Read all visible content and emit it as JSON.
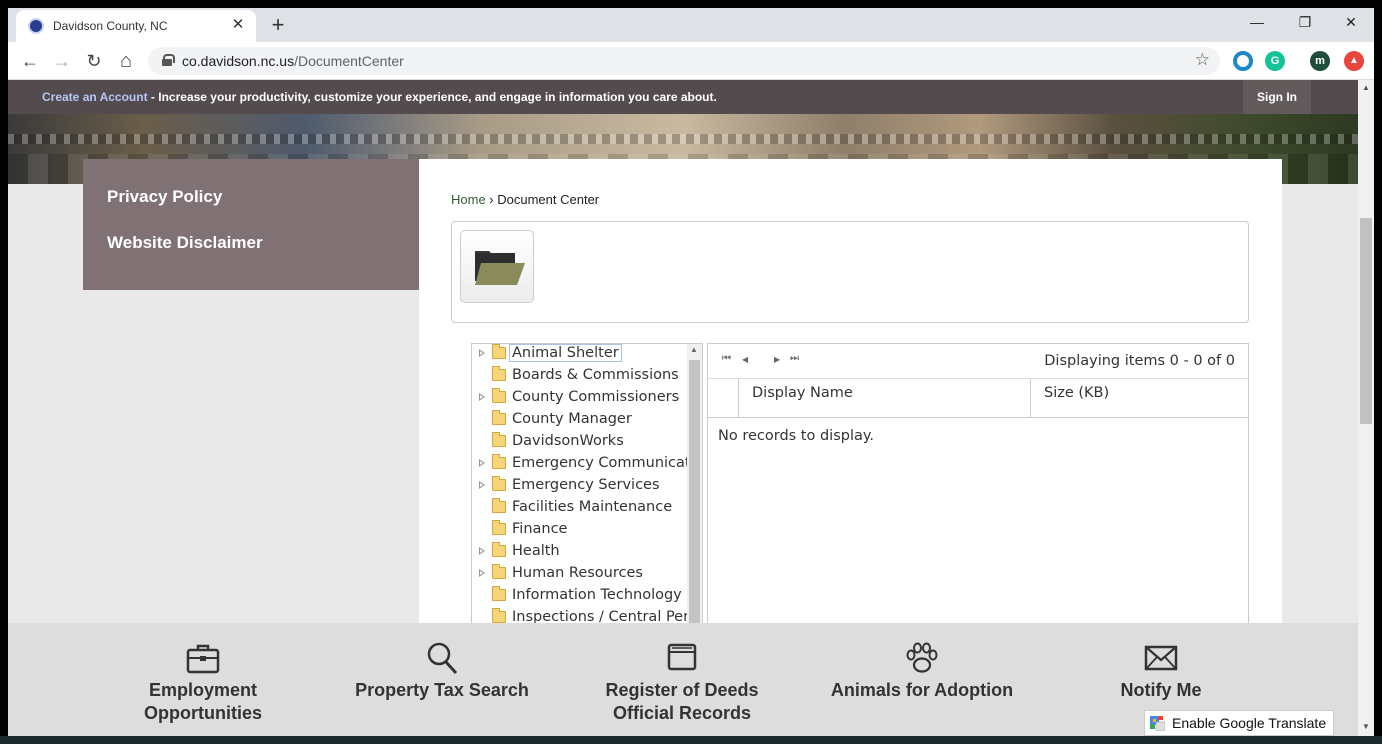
{
  "browser": {
    "tab_title": "Davidson County, NC",
    "tab_close": "✕",
    "new_tab": "+",
    "minimize": "—",
    "maximize": "❐",
    "close": "✕",
    "back": "←",
    "forward": "→",
    "reload": "↻",
    "home": "⌂",
    "url_host": "co.davidson.nc.us",
    "url_path": "/DocumentCenter",
    "bookmark_star": "☆",
    "ext_grammarly": "G",
    "profile_initial": "m"
  },
  "topbar": {
    "create_account": "Create an Account",
    "message": " - Increase your productivity, customize your experience, and engage in information you care about.",
    "sign_in": "Sign In"
  },
  "sidenav": {
    "items": [
      {
        "label": "Privacy Policy"
      },
      {
        "label": "Website Disclaimer"
      }
    ]
  },
  "breadcrumb": {
    "home": "Home",
    "separator": " › ",
    "current": "Document Center"
  },
  "tree": {
    "items": [
      {
        "label": "Animal Shelter",
        "expandable": true,
        "selected": true
      },
      {
        "label": "Boards & Commissions",
        "expandable": false
      },
      {
        "label": "County Commissioners",
        "expandable": true
      },
      {
        "label": "County Manager",
        "expandable": false
      },
      {
        "label": "DavidsonWorks",
        "expandable": false
      },
      {
        "label": "Emergency Communicati",
        "expandable": true
      },
      {
        "label": "Emergency Services",
        "expandable": true
      },
      {
        "label": "Facilities Maintenance",
        "expandable": false
      },
      {
        "label": "Finance",
        "expandable": false
      },
      {
        "label": "Health",
        "expandable": true
      },
      {
        "label": "Human Resources",
        "expandable": true
      },
      {
        "label": "Information Technology",
        "expandable": false
      },
      {
        "label": "Inspections / Central Peri",
        "expandable": false
      }
    ]
  },
  "grid": {
    "pager_first": "⏮",
    "pager_prev": "◀",
    "pager_next": "▶",
    "pager_last": "⏭",
    "info": "Displaying items 0 - 0 of 0",
    "col_name": "Display Name",
    "col_size": "Size (KB)",
    "empty": "No records to display."
  },
  "footer": {
    "items": [
      {
        "label_line1": "Employment",
        "label_line2": "Opportunities",
        "icon": "briefcase-icon"
      },
      {
        "label_line1": "Property Tax Search",
        "label_line2": "",
        "icon": "magnifier-icon"
      },
      {
        "label_line1": "Register of Deeds",
        "label_line2": "Official Records",
        "icon": "folder-icon"
      },
      {
        "label_line1": "Animals for Adoption",
        "label_line2": "",
        "icon": "paw-icon"
      },
      {
        "label_line1": "Notify Me",
        "label_line2": "",
        "icon": "envelope-icon"
      }
    ]
  },
  "translate": {
    "label": "Enable Google Translate"
  }
}
